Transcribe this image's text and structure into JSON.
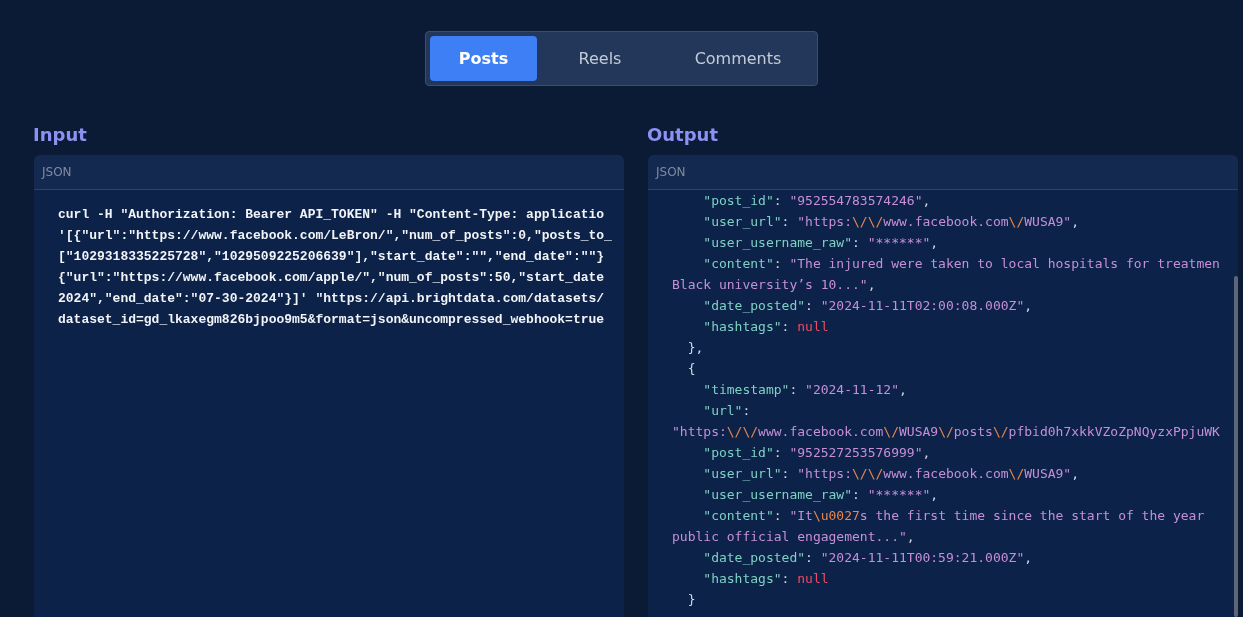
{
  "tabs": [
    {
      "label": "Posts",
      "selected": true
    },
    {
      "label": "Reels",
      "selected": false
    },
    {
      "label": "Comments",
      "selected": false
    }
  ],
  "input": {
    "title": "Input",
    "panel_label": "JSON",
    "lines": [
      "curl -H \"Authorization: Bearer API_TOKEN\" -H \"Content-Type: applicatio",
      "'[{\"url\":\"https://www.facebook.com/LeBron/\",\"num_of_posts\":0,\"posts_to_",
      "[\"1029318335225728\",\"1029509225206639\"],\"start_date\":\"\",\"end_date\":\"\"}",
      "{\"url\":\"https://www.facebook.com/apple/\",\"num_of_posts\":50,\"start_date",
      "2024\",\"end_date\":\"07-30-2024\"}]' \"https://api.brightdata.com/datasets/",
      "dataset_id=gd_lkaxegm826bjpoo9m5&format=json&uncompressed_webhook=true"
    ]
  },
  "output": {
    "title": "Output",
    "panel_label": "JSON",
    "lines": [
      [
        {
          "kind": "key",
          "text": "    \"post_id\""
        },
        {
          "kind": "punct",
          "text": ": "
        },
        {
          "kind": "string",
          "text": "\"952554783574246\""
        },
        {
          "kind": "punct",
          "text": ","
        }
      ],
      [
        {
          "kind": "key",
          "text": "    \"user_url\""
        },
        {
          "kind": "punct",
          "text": ": "
        },
        {
          "kind": "string",
          "text": "\"https:"
        },
        {
          "kind": "escape",
          "text": "\\/\\/"
        },
        {
          "kind": "string",
          "text": "www.facebook.com"
        },
        {
          "kind": "escape",
          "text": "\\/"
        },
        {
          "kind": "string",
          "text": "WUSA9\""
        },
        {
          "kind": "punct",
          "text": ","
        }
      ],
      [
        {
          "kind": "key",
          "text": "    \"user_username_raw\""
        },
        {
          "kind": "punct",
          "text": ": "
        },
        {
          "kind": "string",
          "text": "\"******\""
        },
        {
          "kind": "punct",
          "text": ","
        }
      ],
      [
        {
          "kind": "key",
          "text": "    \"content\""
        },
        {
          "kind": "punct",
          "text": ": "
        },
        {
          "kind": "string",
          "text": "\"The injured were taken to local hospitals for treatmen"
        }
      ],
      [
        {
          "kind": "string",
          "text": "Black university’s 10...\""
        },
        {
          "kind": "punct",
          "text": ","
        }
      ],
      [
        {
          "kind": "key",
          "text": "    \"date_posted\""
        },
        {
          "kind": "punct",
          "text": ": "
        },
        {
          "kind": "string",
          "text": "\"2024-11-11T02:00:08.000Z\""
        },
        {
          "kind": "punct",
          "text": ","
        }
      ],
      [
        {
          "kind": "key",
          "text": "    \"hashtags\""
        },
        {
          "kind": "punct",
          "text": ": "
        },
        {
          "kind": "null",
          "text": "null"
        }
      ],
      [
        {
          "kind": "punct",
          "text": "  },"
        }
      ],
      [
        {
          "kind": "punct",
          "text": "  {"
        }
      ],
      [
        {
          "kind": "key",
          "text": "    \"timestamp\""
        },
        {
          "kind": "punct",
          "text": ": "
        },
        {
          "kind": "string",
          "text": "\"2024-11-12\""
        },
        {
          "kind": "punct",
          "text": ","
        }
      ],
      [
        {
          "kind": "key",
          "text": "    \"url\""
        },
        {
          "kind": "punct",
          "text": ":"
        }
      ],
      [
        {
          "kind": "string",
          "text": "\"https:"
        },
        {
          "kind": "escape",
          "text": "\\/\\/"
        },
        {
          "kind": "string",
          "text": "www.facebook.com"
        },
        {
          "kind": "escape",
          "text": "\\/"
        },
        {
          "kind": "string",
          "text": "WUSA9"
        },
        {
          "kind": "escape",
          "text": "\\/"
        },
        {
          "kind": "string",
          "text": "posts"
        },
        {
          "kind": "escape",
          "text": "\\/"
        },
        {
          "kind": "string",
          "text": "pfbid0h7xkkVZoZpNQyzxPpjuWK"
        }
      ],
      [
        {
          "kind": "key",
          "text": "    \"post_id\""
        },
        {
          "kind": "punct",
          "text": ": "
        },
        {
          "kind": "string",
          "text": "\"952527253576999\""
        },
        {
          "kind": "punct",
          "text": ","
        }
      ],
      [
        {
          "kind": "key",
          "text": "    \"user_url\""
        },
        {
          "kind": "punct",
          "text": ": "
        },
        {
          "kind": "string",
          "text": "\"https:"
        },
        {
          "kind": "escape",
          "text": "\\/\\/"
        },
        {
          "kind": "string",
          "text": "www.facebook.com"
        },
        {
          "kind": "escape",
          "text": "\\/"
        },
        {
          "kind": "string",
          "text": "WUSA9\""
        },
        {
          "kind": "punct",
          "text": ","
        }
      ],
      [
        {
          "kind": "key",
          "text": "    \"user_username_raw\""
        },
        {
          "kind": "punct",
          "text": ": "
        },
        {
          "kind": "string",
          "text": "\"******\""
        },
        {
          "kind": "punct",
          "text": ","
        }
      ],
      [
        {
          "kind": "key",
          "text": "    \"content\""
        },
        {
          "kind": "punct",
          "text": ": "
        },
        {
          "kind": "string",
          "text": "\"It"
        },
        {
          "kind": "escape",
          "text": "\\u0027"
        },
        {
          "kind": "string",
          "text": "s the first time since the start of the year"
        }
      ],
      [
        {
          "kind": "string",
          "text": "public official engagement...\""
        },
        {
          "kind": "punct",
          "text": ","
        }
      ],
      [
        {
          "kind": "key",
          "text": "    \"date_posted\""
        },
        {
          "kind": "punct",
          "text": ": "
        },
        {
          "kind": "string",
          "text": "\"2024-11-11T00:59:21.000Z\""
        },
        {
          "kind": "punct",
          "text": ","
        }
      ],
      [
        {
          "kind": "key",
          "text": "    \"hashtags\""
        },
        {
          "kind": "punct",
          "text": ": "
        },
        {
          "kind": "null",
          "text": "null"
        }
      ],
      [
        {
          "kind": "punct",
          "text": "  }"
        }
      ]
    ]
  }
}
